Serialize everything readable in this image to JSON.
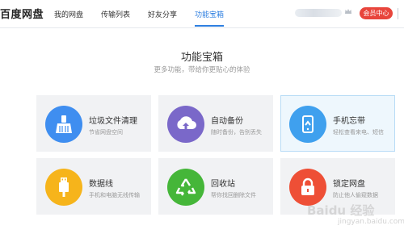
{
  "header": {
    "logo_text": "百度网盘",
    "nav": [
      "我的网盘",
      "传输列表",
      "好友分享",
      "功能宝箱"
    ],
    "vip_label": "会员中心"
  },
  "main": {
    "title": "功能宝箱",
    "subtitle": "更多功能，带给你更贴心的体验"
  },
  "cards": [
    {
      "name": "垃圾文件清理",
      "desc": "节省网盘空间",
      "icon": "broom-icon",
      "color": "#3f8ef0"
    },
    {
      "name": "自动备份",
      "desc": "随时备份，告别丢失",
      "icon": "cloud-upload-icon",
      "color": "#7a68c9"
    },
    {
      "name": "手机忘带",
      "desc": "轻松查看来电、短信",
      "icon": "phone-icon",
      "color": "#3fa0ee"
    },
    {
      "name": "数据线",
      "desc": "手机和电脑无线传输",
      "icon": "usb-icon",
      "color": "#f6b41b"
    },
    {
      "name": "回收站",
      "desc": "帮你找回删除文件",
      "icon": "recycle-icon",
      "color": "#45b639"
    },
    {
      "name": "锁定网盘",
      "desc": "防止他人偷窥数据",
      "icon": "lock-icon",
      "color": "#ee4f36"
    }
  ],
  "watermark": {
    "text": "Baidu 经验",
    "sub": "jingyan.baidu.com"
  }
}
